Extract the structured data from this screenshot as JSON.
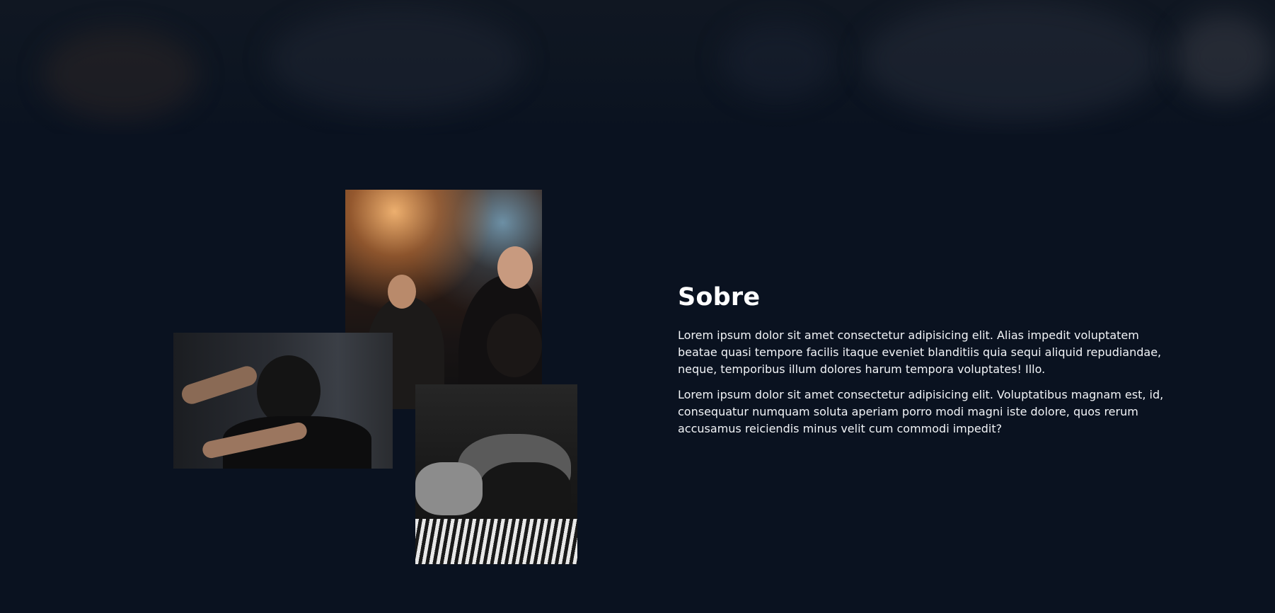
{
  "about": {
    "title": "Sobre",
    "paragraphs": [
      "Lorem ipsum dolor sit amet consectetur adipisicing elit. Alias impedit voluptatem beatae quasi tempore facilis itaque eveniet blanditiis quia sequi aliquid repudiandae, neque, temporibus illum dolores harum tempora voluptates! Illo.",
      "Lorem ipsum dolor sit amet consectetur adipisicing elit. Voluptatibus magnam est, id, consequatur numquam soluta aperiam porro modi magni iste dolore, quos rerum accusamus reiciendis minus velit cum commodi impedit?"
    ]
  },
  "colors": {
    "background": "#0a1220",
    "text": "#ffffff"
  }
}
